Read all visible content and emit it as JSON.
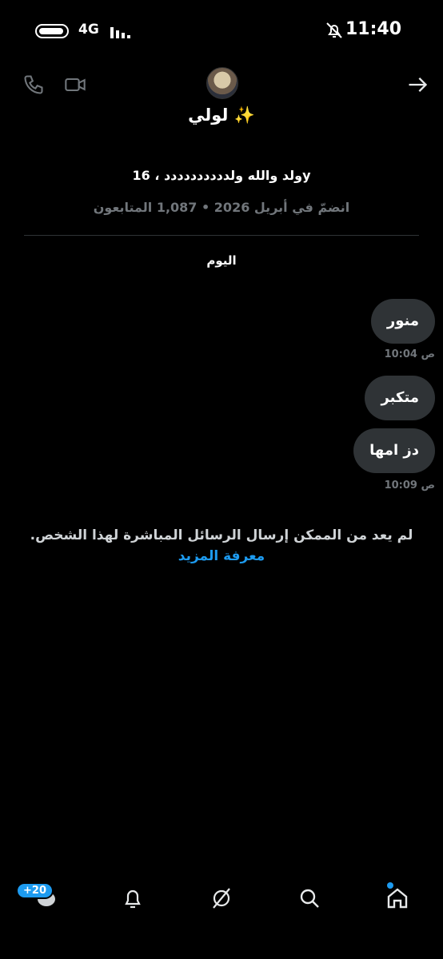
{
  "status_bar": {
    "network": "4G",
    "time": "11:40"
  },
  "header": {
    "name": "لولي ✨",
    "bio": "ولد والله ولدددددددددد ، 16y",
    "meta": "انضمّ في أبريل 2026 • 1,087 المتابعون"
  },
  "conversation": {
    "day_label": "اليوم",
    "messages": [
      {
        "text": "منور",
        "time": "10:04 ص"
      },
      {
        "text": "متكبر",
        "time": ""
      },
      {
        "text": "دز امها",
        "time": "10:09 ص"
      }
    ],
    "notice": "لم يعد من الممكن إرسال الرسائل المباشرة لهذا الشخص.",
    "learn_more": "معرفة المزيد"
  },
  "bottom_nav": {
    "badge": "+20",
    "items": [
      "messages-icon",
      "notifications-icon",
      "grok-icon",
      "search-icon",
      "home-icon"
    ]
  },
  "colors": {
    "background": "#000000",
    "bubble": "#2f3336",
    "accent": "#1d9bf0",
    "muted": "#71767b"
  }
}
